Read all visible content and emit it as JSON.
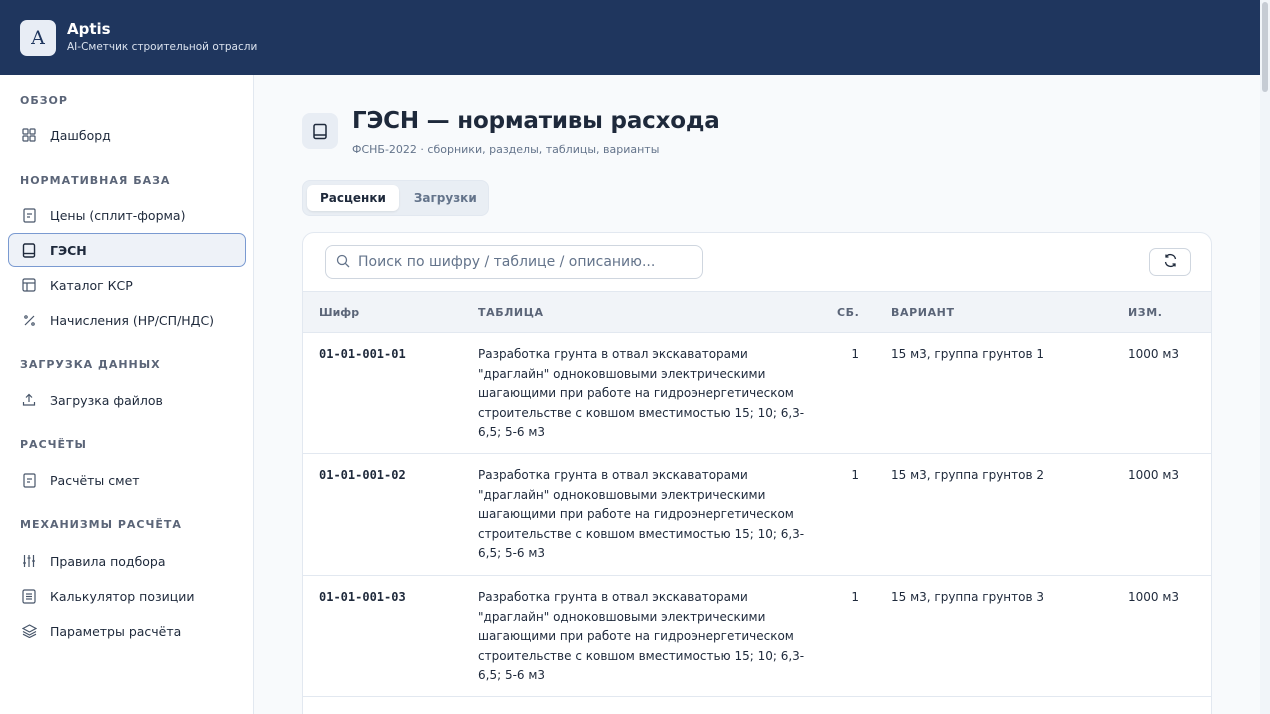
{
  "app": {
    "logo_letter": "A",
    "name": "Aptis",
    "subtitle": "AI-Сметчик строительной отрасли"
  },
  "sidebar": {
    "sections": [
      "ОБЗОР",
      "НОРМАТИВНАЯ БАЗА",
      "ЗАГРУЗКА ДАННЫХ",
      "РАСЧЁТЫ",
      "МЕХАНИЗМЫ РАСЧЁТА"
    ],
    "items": [
      {
        "label": "Дашборд",
        "icon": "grid-icon"
      },
      {
        "label": "Цены (сплит-форма)",
        "icon": "document-icon"
      },
      {
        "label": "ГЭСН",
        "icon": "book-icon",
        "active": true
      },
      {
        "label": "Каталог КСР",
        "icon": "table-icon"
      },
      {
        "label": "Начисления (НР/СП/НДС)",
        "icon": "percent-icon"
      },
      {
        "label": "Загрузка файлов",
        "icon": "upload-icon"
      },
      {
        "label": "Расчёты смет",
        "icon": "document-icon"
      },
      {
        "label": "Правила подбора",
        "icon": "sliders-icon"
      },
      {
        "label": "Калькулятор позиции",
        "icon": "list-icon"
      },
      {
        "label": "Параметры расчёта",
        "icon": "layers-icon"
      }
    ]
  },
  "page": {
    "title": "ГЭСН — нормативы расхода",
    "subtitle": "ФСНБ-2022 · сборники, разделы, таблицы, варианты"
  },
  "tabs": [
    {
      "label": "Расценки",
      "active": true
    },
    {
      "label": "Загрузки",
      "active": false
    }
  ],
  "search": {
    "placeholder": "Поиск по шифру / таблице / описанию..."
  },
  "table": {
    "columns": [
      "Шифр",
      "ТАБЛИЦА",
      "СБ.",
      "ВАРИАНТ",
      "ИЗМ."
    ],
    "rows": [
      {
        "code": "01-01-001-01",
        "table": "Разработка грунта в отвал экскаваторами \"драглайн\" одноковшовыми электрическими шагающими при работе на гидроэнергетическом строительстве с ковшом вместимостью 15; 10; 6,3-6,5; 5-6 м3",
        "sb": "1",
        "variant": "15 м3, группа грунтов 1",
        "unit": "1000 м3"
      },
      {
        "code": "01-01-001-02",
        "table": "Разработка грунта в отвал экскаваторами \"драглайн\" одноковшовыми электрическими шагающими при работе на гидроэнергетическом строительстве с ковшом вместимостью 15; 10; 6,3-6,5; 5-6 м3",
        "sb": "1",
        "variant": "15 м3, группа грунтов 2",
        "unit": "1000 м3"
      },
      {
        "code": "01-01-001-03",
        "table": "Разработка грунта в отвал экскаваторами \"драглайн\" одноковшовыми электрическими шагающими при работе на гидроэнергетическом строительстве с ковшом вместимостью 15; 10; 6,3-6,5; 5-6 м3",
        "sb": "1",
        "variant": "15 м3, группа грунтов 3",
        "unit": "1000 м3"
      }
    ]
  }
}
